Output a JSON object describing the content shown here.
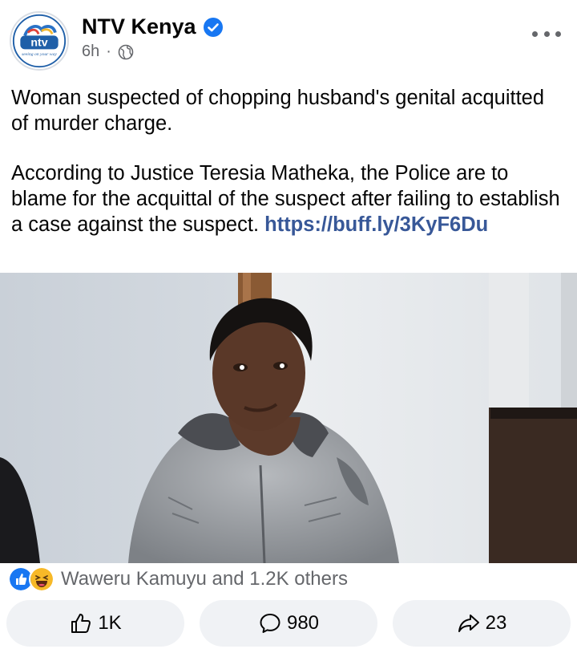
{
  "post": {
    "page_name": "NTV Kenya",
    "verified_icon": "verified-badge-icon",
    "time": "6h",
    "separator": "·",
    "audience_icon": "globe-icon",
    "more_icon": "more-options-icon",
    "avatar_logo_text": "ntv",
    "avatar_tagline": "seeing on your way",
    "text_line1": "Woman suspected of chopping husband's genital acquitted of murder charge.",
    "text_para2": "According to Justice Teresia Matheka, the Police are to blame for the acquittal of the suspect after failing to establish a case against the suspect.",
    "link": "https://buff.ly/3KyF6Du"
  },
  "reactions": {
    "icons": [
      "like-reaction-icon",
      "haha-reaction-icon"
    ],
    "summary": "Waweru Kamuyu and 1.2K others"
  },
  "actions": {
    "like_count": "1K",
    "comment_count": "980",
    "share_count": "23"
  },
  "colors": {
    "link": "#385898",
    "facebook_blue": "#1877f2",
    "secondary_text": "#65676b",
    "button_bg": "#f0f2f5"
  }
}
